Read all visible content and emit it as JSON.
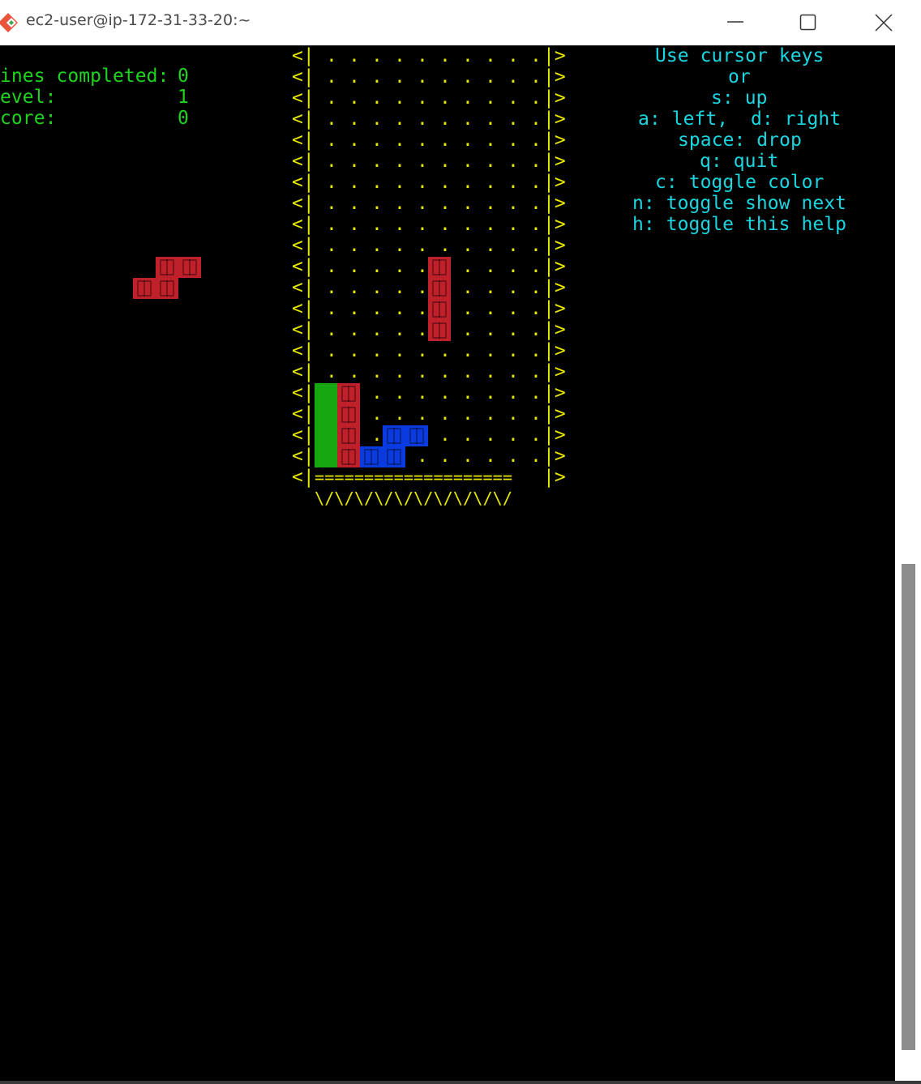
{
  "window": {
    "title": "ec2-user@ip-172-31-33-20:~",
    "icon": "git-bash-icon",
    "controls": {
      "minimize": "minimize-icon",
      "maximize": "maximize-icon",
      "close": "close-icon"
    }
  },
  "stats": {
    "lines_label": "ines completed:",
    "lines_value": "0",
    "level_label": "evel:",
    "level_value": "1",
    "score_label": "core:",
    "score_value": "0"
  },
  "help": {
    "lines": [
      "Use cursor keys",
      "or",
      "s: up",
      "a: left,  d: right",
      "space: drop",
      "q: quit",
      "c: toggle color",
      "n: toggle show next",
      "h: toggle this help"
    ]
  },
  "board": {
    "wall_left": "<|",
    "wall_right": "|>",
    "empty_row": " . . . . . . . . . .",
    "floor": "====================",
    "base": "\\/\\/\\/\\/\\/\\/\\/\\/\\/\\/",
    "columns": 10,
    "rows": 20,
    "cells": [
      {
        "row": 10,
        "col": 5,
        "color": "red"
      },
      {
        "row": 11,
        "col": 5,
        "color": "red"
      },
      {
        "row": 12,
        "col": 5,
        "color": "red"
      },
      {
        "row": 13,
        "col": 5,
        "color": "red"
      },
      {
        "row": 16,
        "col": 0,
        "color": "green"
      },
      {
        "row": 17,
        "col": 0,
        "color": "green"
      },
      {
        "row": 18,
        "col": 0,
        "color": "green"
      },
      {
        "row": 19,
        "col": 0,
        "color": "green"
      },
      {
        "row": 16,
        "col": 1,
        "color": "red"
      },
      {
        "row": 17,
        "col": 1,
        "color": "red"
      },
      {
        "row": 18,
        "col": 1,
        "color": "red"
      },
      {
        "row": 19,
        "col": 1,
        "color": "red"
      },
      {
        "row": 18,
        "col": 3,
        "color": "blue"
      },
      {
        "row": 18,
        "col": 4,
        "color": "blue"
      },
      {
        "row": 19,
        "col": 2,
        "color": "blue"
      },
      {
        "row": 19,
        "col": 3,
        "color": "blue"
      }
    ]
  },
  "next_piece": {
    "color": "red",
    "cells": [
      {
        "row": 0,
        "col": 1
      },
      {
        "row": 0,
        "col": 2
      },
      {
        "row": 1,
        "col": 0
      },
      {
        "row": 1,
        "col": 1
      }
    ]
  },
  "colors": {
    "stats_text": "#1fd31f",
    "help_text": "#1ad6e0",
    "board_text": "#e8e800",
    "red": "#c0202a",
    "blue": "#0a3be0",
    "green": "#17a811"
  }
}
